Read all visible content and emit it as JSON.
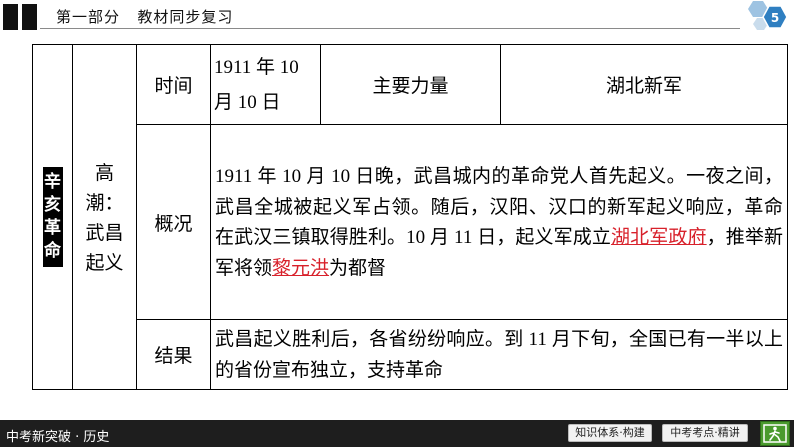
{
  "header": {
    "section": "第一部分",
    "subtitle": "教材同步复习",
    "page_number": "5"
  },
  "table": {
    "vertical_label": [
      "辛",
      "亥",
      "革",
      "命"
    ],
    "sub_label": [
      "高",
      "潮：",
      "武昌",
      "起义"
    ],
    "row_time": {
      "label": "时间",
      "date_line1": "1911 年 10",
      "date_line2": "月 10 日",
      "force_label": "主要力量",
      "force_value": "湖北新军"
    },
    "row_overview": {
      "label": "概况",
      "text_before": "1911 年 10 月 10 日晚，武昌城内的革命党人首先起义。一夜之间，武昌全城被起义军占领。随后，汉阳、汉口的新军起义响应，革命在武汉三镇取得胜利。10 月 11 日，起义军成立",
      "highlight1": "湖北军政府",
      "text_middle": "，推举新军将领",
      "highlight2": "黎元洪",
      "text_after": "为都督"
    },
    "row_result": {
      "label": "结果",
      "text": "武昌起义胜利后，各省纷纷响应。到 11 月下旬，全国已有一半以上的省份宣布独立，支持革命"
    }
  },
  "footer": {
    "brand": "中考新突破 · 历史",
    "btn_knowledge": "知识体系·构建",
    "btn_exam": "中考考点·精讲"
  },
  "colors": {
    "highlight": "#d8212b",
    "footer_bg": "#1e1e1e",
    "exit_green": "#4a9a2e",
    "hex_blue": "#2f7fc1"
  },
  "icons": {
    "page_badge": "hexagon-badge-icon",
    "exit": "exit-door-icon"
  }
}
